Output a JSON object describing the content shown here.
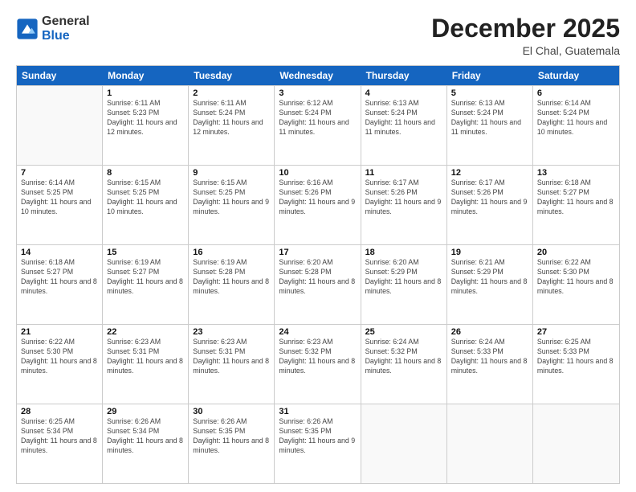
{
  "header": {
    "logo_general": "General",
    "logo_blue": "Blue",
    "month_year": "December 2025",
    "location": "El Chal, Guatemala"
  },
  "calendar": {
    "days_of_week": [
      "Sunday",
      "Monday",
      "Tuesday",
      "Wednesday",
      "Thursday",
      "Friday",
      "Saturday"
    ],
    "weeks": [
      [
        {
          "day": "",
          "sunrise": "",
          "sunset": "",
          "daylight": ""
        },
        {
          "day": "1",
          "sunrise": "Sunrise: 6:11 AM",
          "sunset": "Sunset: 5:23 PM",
          "daylight": "Daylight: 11 hours and 12 minutes."
        },
        {
          "day": "2",
          "sunrise": "Sunrise: 6:11 AM",
          "sunset": "Sunset: 5:24 PM",
          "daylight": "Daylight: 11 hours and 12 minutes."
        },
        {
          "day": "3",
          "sunrise": "Sunrise: 6:12 AM",
          "sunset": "Sunset: 5:24 PM",
          "daylight": "Daylight: 11 hours and 11 minutes."
        },
        {
          "day": "4",
          "sunrise": "Sunrise: 6:13 AM",
          "sunset": "Sunset: 5:24 PM",
          "daylight": "Daylight: 11 hours and 11 minutes."
        },
        {
          "day": "5",
          "sunrise": "Sunrise: 6:13 AM",
          "sunset": "Sunset: 5:24 PM",
          "daylight": "Daylight: 11 hours and 11 minutes."
        },
        {
          "day": "6",
          "sunrise": "Sunrise: 6:14 AM",
          "sunset": "Sunset: 5:24 PM",
          "daylight": "Daylight: 11 hours and 10 minutes."
        }
      ],
      [
        {
          "day": "7",
          "sunrise": "Sunrise: 6:14 AM",
          "sunset": "Sunset: 5:25 PM",
          "daylight": "Daylight: 11 hours and 10 minutes."
        },
        {
          "day": "8",
          "sunrise": "Sunrise: 6:15 AM",
          "sunset": "Sunset: 5:25 PM",
          "daylight": "Daylight: 11 hours and 10 minutes."
        },
        {
          "day": "9",
          "sunrise": "Sunrise: 6:15 AM",
          "sunset": "Sunset: 5:25 PM",
          "daylight": "Daylight: 11 hours and 9 minutes."
        },
        {
          "day": "10",
          "sunrise": "Sunrise: 6:16 AM",
          "sunset": "Sunset: 5:26 PM",
          "daylight": "Daylight: 11 hours and 9 minutes."
        },
        {
          "day": "11",
          "sunrise": "Sunrise: 6:17 AM",
          "sunset": "Sunset: 5:26 PM",
          "daylight": "Daylight: 11 hours and 9 minutes."
        },
        {
          "day": "12",
          "sunrise": "Sunrise: 6:17 AM",
          "sunset": "Sunset: 5:26 PM",
          "daylight": "Daylight: 11 hours and 9 minutes."
        },
        {
          "day": "13",
          "sunrise": "Sunrise: 6:18 AM",
          "sunset": "Sunset: 5:27 PM",
          "daylight": "Daylight: 11 hours and 8 minutes."
        }
      ],
      [
        {
          "day": "14",
          "sunrise": "Sunrise: 6:18 AM",
          "sunset": "Sunset: 5:27 PM",
          "daylight": "Daylight: 11 hours and 8 minutes."
        },
        {
          "day": "15",
          "sunrise": "Sunrise: 6:19 AM",
          "sunset": "Sunset: 5:27 PM",
          "daylight": "Daylight: 11 hours and 8 minutes."
        },
        {
          "day": "16",
          "sunrise": "Sunrise: 6:19 AM",
          "sunset": "Sunset: 5:28 PM",
          "daylight": "Daylight: 11 hours and 8 minutes."
        },
        {
          "day": "17",
          "sunrise": "Sunrise: 6:20 AM",
          "sunset": "Sunset: 5:28 PM",
          "daylight": "Daylight: 11 hours and 8 minutes."
        },
        {
          "day": "18",
          "sunrise": "Sunrise: 6:20 AM",
          "sunset": "Sunset: 5:29 PM",
          "daylight": "Daylight: 11 hours and 8 minutes."
        },
        {
          "day": "19",
          "sunrise": "Sunrise: 6:21 AM",
          "sunset": "Sunset: 5:29 PM",
          "daylight": "Daylight: 11 hours and 8 minutes."
        },
        {
          "day": "20",
          "sunrise": "Sunrise: 6:22 AM",
          "sunset": "Sunset: 5:30 PM",
          "daylight": "Daylight: 11 hours and 8 minutes."
        }
      ],
      [
        {
          "day": "21",
          "sunrise": "Sunrise: 6:22 AM",
          "sunset": "Sunset: 5:30 PM",
          "daylight": "Daylight: 11 hours and 8 minutes."
        },
        {
          "day": "22",
          "sunrise": "Sunrise: 6:23 AM",
          "sunset": "Sunset: 5:31 PM",
          "daylight": "Daylight: 11 hours and 8 minutes."
        },
        {
          "day": "23",
          "sunrise": "Sunrise: 6:23 AM",
          "sunset": "Sunset: 5:31 PM",
          "daylight": "Daylight: 11 hours and 8 minutes."
        },
        {
          "day": "24",
          "sunrise": "Sunrise: 6:23 AM",
          "sunset": "Sunset: 5:32 PM",
          "daylight": "Daylight: 11 hours and 8 minutes."
        },
        {
          "day": "25",
          "sunrise": "Sunrise: 6:24 AM",
          "sunset": "Sunset: 5:32 PM",
          "daylight": "Daylight: 11 hours and 8 minutes."
        },
        {
          "day": "26",
          "sunrise": "Sunrise: 6:24 AM",
          "sunset": "Sunset: 5:33 PM",
          "daylight": "Daylight: 11 hours and 8 minutes."
        },
        {
          "day": "27",
          "sunrise": "Sunrise: 6:25 AM",
          "sunset": "Sunset: 5:33 PM",
          "daylight": "Daylight: 11 hours and 8 minutes."
        }
      ],
      [
        {
          "day": "28",
          "sunrise": "Sunrise: 6:25 AM",
          "sunset": "Sunset: 5:34 PM",
          "daylight": "Daylight: 11 hours and 8 minutes."
        },
        {
          "day": "29",
          "sunrise": "Sunrise: 6:26 AM",
          "sunset": "Sunset: 5:34 PM",
          "daylight": "Daylight: 11 hours and 8 minutes."
        },
        {
          "day": "30",
          "sunrise": "Sunrise: 6:26 AM",
          "sunset": "Sunset: 5:35 PM",
          "daylight": "Daylight: 11 hours and 8 minutes."
        },
        {
          "day": "31",
          "sunrise": "Sunrise: 6:26 AM",
          "sunset": "Sunset: 5:35 PM",
          "daylight": "Daylight: 11 hours and 9 minutes."
        },
        {
          "day": "",
          "sunrise": "",
          "sunset": "",
          "daylight": ""
        },
        {
          "day": "",
          "sunrise": "",
          "sunset": "",
          "daylight": ""
        },
        {
          "day": "",
          "sunrise": "",
          "sunset": "",
          "daylight": ""
        }
      ]
    ]
  }
}
